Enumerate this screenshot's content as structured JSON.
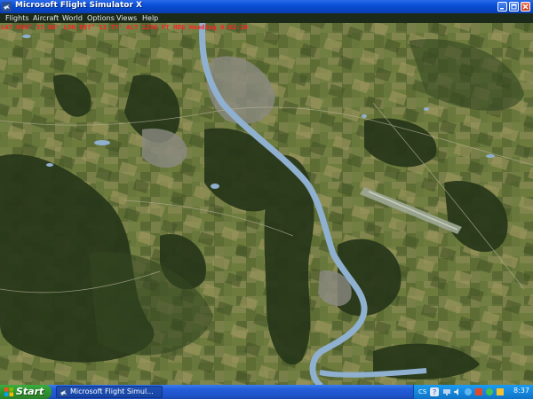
{
  "window": {
    "title": "Microsoft Flight Simulator X",
    "controls": [
      "minimize",
      "maximize",
      "close"
    ]
  },
  "menu": {
    "items": [
      "Flights",
      "Aircraft",
      "World",
      "Options",
      "Views",
      "Help"
    ]
  },
  "map": {
    "status_readout": "LAT N50° 37.06'  LON E07° 13.77'  ALT 1250 FT  HDG  Heading  0:02:10"
  },
  "taskbar": {
    "start_label": "Start",
    "task_label": "Microsoft Flight Simul...",
    "tray_lang": "CS",
    "clock": "8:37"
  },
  "icons": {
    "app": "flightsim-app-icon",
    "start": "windows-logo-icon",
    "tray": [
      "help-icon",
      "network-icon",
      "volume-icon",
      "speaker-icon",
      "antivirus-icon",
      "messenger-icon",
      "update-icon"
    ]
  },
  "colors": {
    "titlebar": "#0a4fd6",
    "taskbar": "#245edb",
    "start_button": "#3cab3c",
    "readout": "#ff2222",
    "river": "#8fb0cf"
  }
}
